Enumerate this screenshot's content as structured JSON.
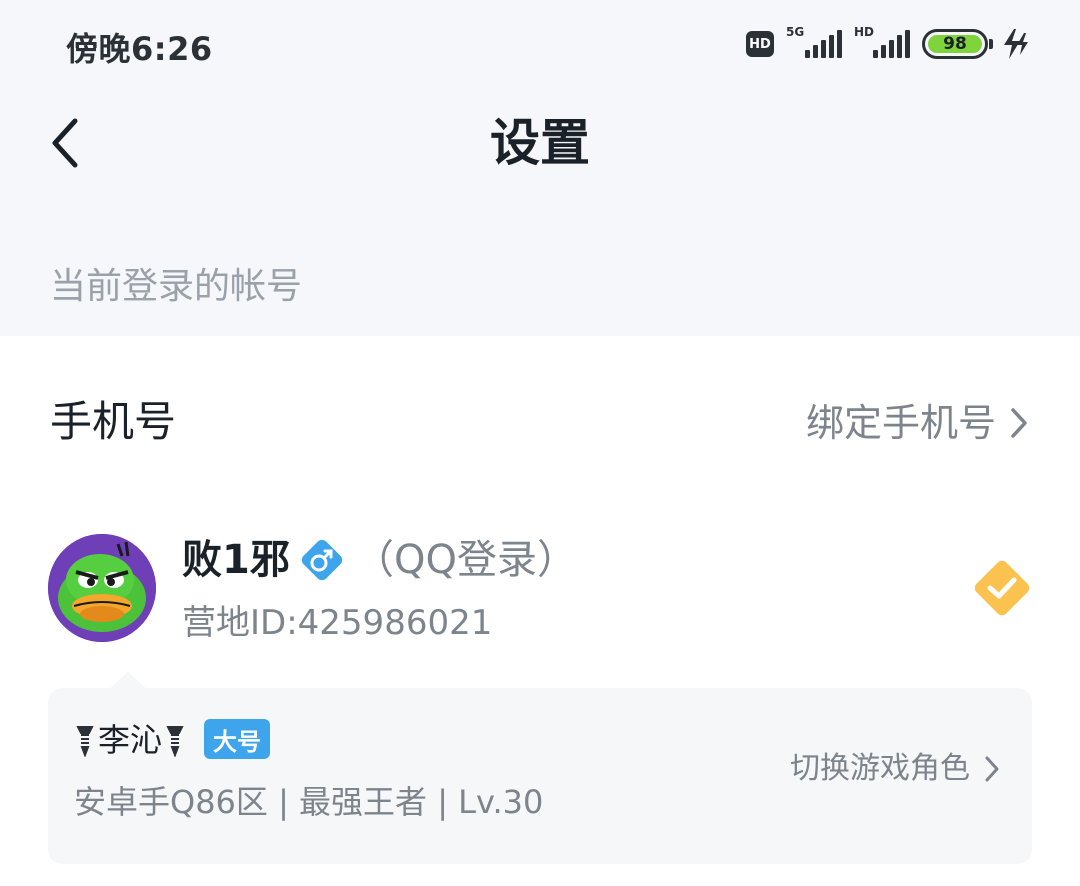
{
  "status_bar": {
    "time": "傍晚6:26",
    "hd_badge": "HD",
    "signal1_tag": "5G",
    "signal2_tag": "HD",
    "battery": "98"
  },
  "header": {
    "title": "设置"
  },
  "section": {
    "label": "当前登录的帐号"
  },
  "phone_row": {
    "label": "手机号",
    "action": "绑定手机号"
  },
  "account": {
    "name": "败1邪",
    "login_type": "（QQ登录）",
    "camp_id": "营地ID:425986021"
  },
  "role": {
    "name": "李沁",
    "badge": "大号",
    "info": "安卓手Q86区 | 最强王者 | Lv.30",
    "switch_label": "切换游戏角色"
  },
  "colors": {
    "background_top": "#f5f7fa",
    "accent_blue": "#3ea5ec",
    "check_orange": "#fbc24f",
    "battery_green": "#7fd33b"
  }
}
